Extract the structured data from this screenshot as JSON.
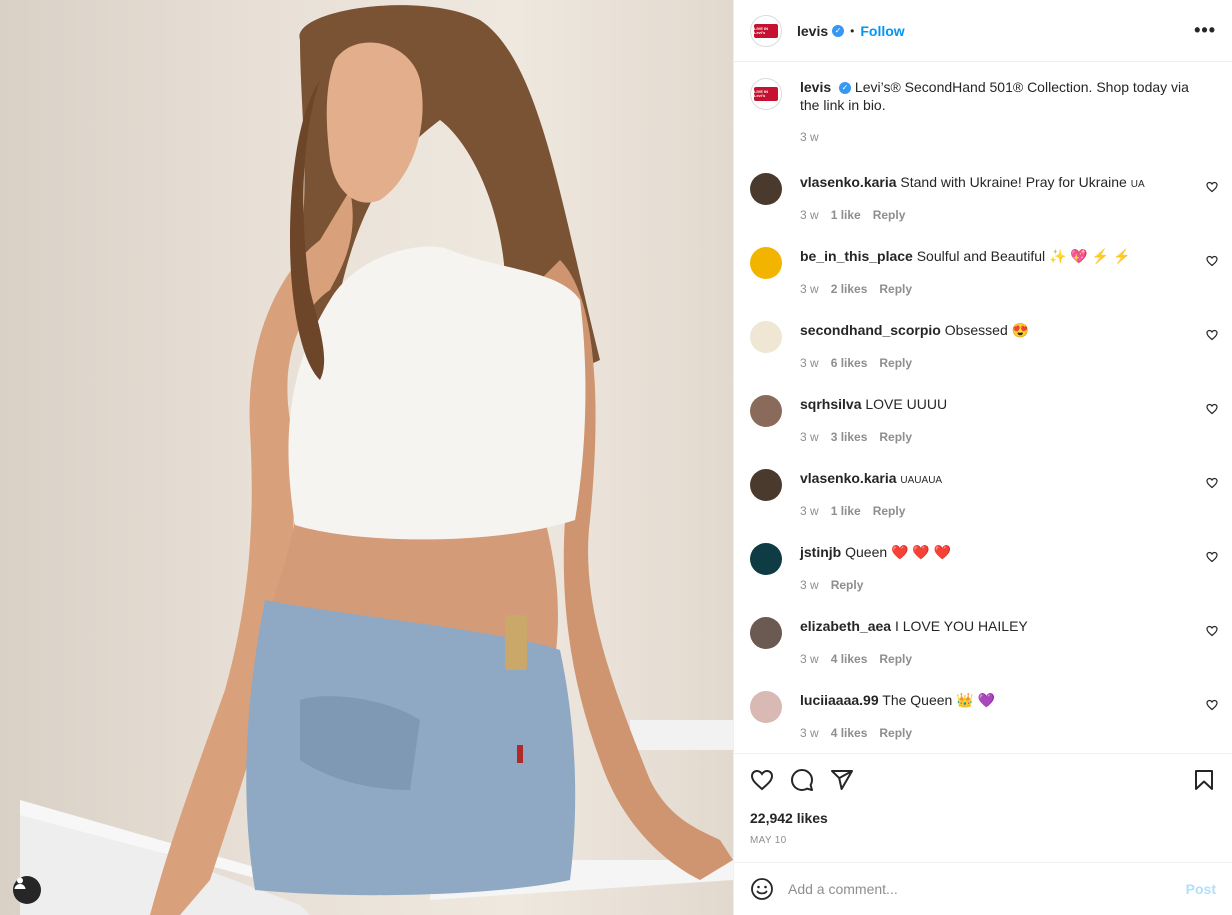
{
  "post": {
    "username": "levis",
    "follow_label": "Follow",
    "dot": "•",
    "avatar_logo_text": "LIVE IN Levi's",
    "image_alt": "Model in white cropped tank top and light-wash jeans sitting on a white bench"
  },
  "caption": {
    "username": "levis",
    "text": "Levi’s® SecondHand 501® Collection. Shop today via the link in bio.",
    "time": "3 w"
  },
  "comments": [
    {
      "username": "vlasenko.karia",
      "text": "Stand with Ukraine! Pray for Ukraine",
      "suffix": "UA",
      "time": "3 w",
      "likes": "1 like",
      "reply": "Reply",
      "avatar_color": "#4a3a2e"
    },
    {
      "username": "be_in_this_place",
      "text": "Soulful and Beautiful ✨ 💖 ⚡ ⚡",
      "suffix": "",
      "time": "3 w",
      "likes": "2 likes",
      "reply": "Reply",
      "avatar_color": "#f3b400"
    },
    {
      "username": "secondhand_scorpio",
      "text": "Obsessed 😍",
      "suffix": "",
      "time": "3 w",
      "likes": "6 likes",
      "reply": "Reply",
      "avatar_color": "#efe6d4"
    },
    {
      "username": "sqrhsilva",
      "text": "LOVE UUUU",
      "suffix": "",
      "time": "3 w",
      "likes": "3 likes",
      "reply": "Reply",
      "avatar_color": "#8a6a5a"
    },
    {
      "username": "vlasenko.karia",
      "text": "",
      "suffix": "UAUAUA",
      "time": "3 w",
      "likes": "1 like",
      "reply": "Reply",
      "avatar_color": "#4a3a2e"
    },
    {
      "username": "jstinjb",
      "text": "Queen ❤️ ❤️ ❤️",
      "suffix": "",
      "time": "3 w",
      "likes": "",
      "reply": "Reply",
      "avatar_color": "#0e3b44"
    },
    {
      "username": "elizabeth_aea",
      "text": "I LOVE YOU HAILEY",
      "suffix": "",
      "time": "3 w",
      "likes": "4 likes",
      "reply": "Reply",
      "avatar_color": "#6b5a52"
    },
    {
      "username": "luciiaaaa.99",
      "text": "The Queen 👑 💜",
      "suffix": "",
      "time": "3 w",
      "likes": "4 likes",
      "reply": "Reply",
      "avatar_color": "#d8b9b4"
    }
  ],
  "stats": {
    "likes": "22,942 likes",
    "date": "MAY 10"
  },
  "add_comment": {
    "placeholder": "Add a comment...",
    "post_label": "Post"
  },
  "colors": {
    "accent": "#0095f6",
    "post_disabled": "#b2dffc",
    "muted": "#8e8e8e",
    "brand": "#c41230"
  }
}
